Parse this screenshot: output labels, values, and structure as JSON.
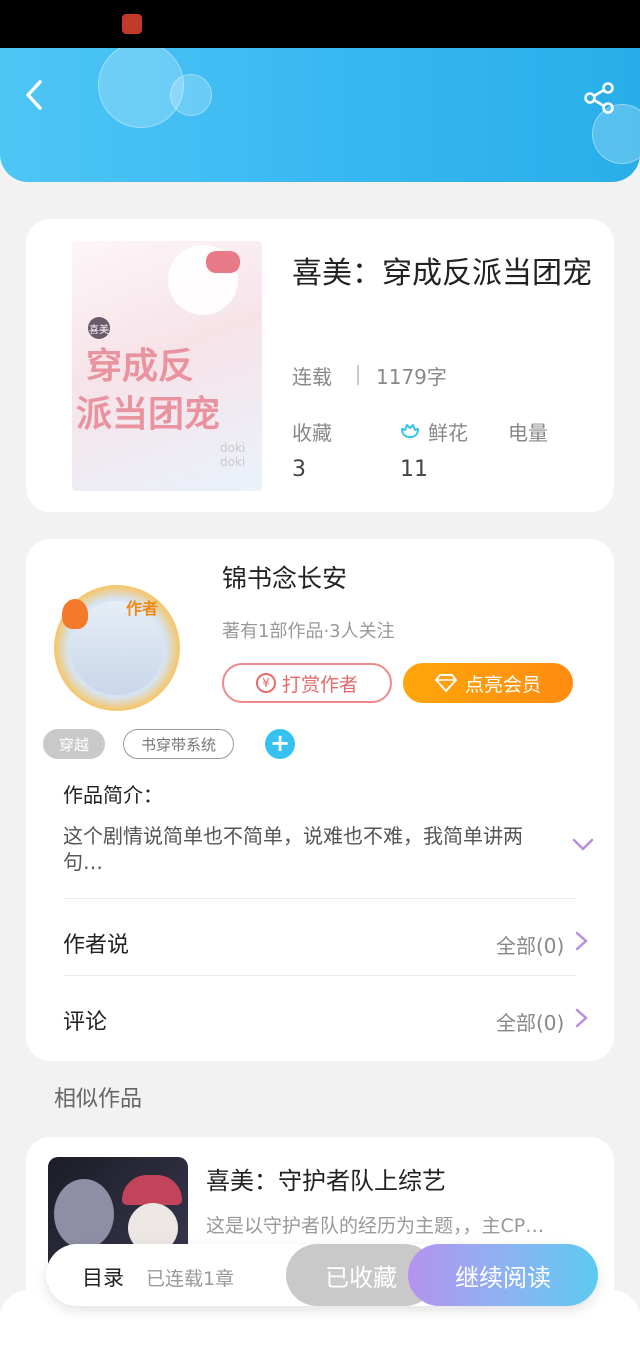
{
  "header": {
    "back_icon": "chevron-left-icon",
    "share_icon": "share-icon",
    "color": "#37b7f2"
  },
  "book": {
    "title": "喜美：穿成反派当团宠",
    "status": "连载",
    "word_count": "1179字",
    "cover_badge": "喜美",
    "cover_text_top": "穿成反",
    "cover_text_bottom": "派当团宠",
    "cover_doki": "doki doki",
    "stats": [
      {
        "label": "收藏",
        "value": "3"
      },
      {
        "label": "鲜花",
        "value": "11",
        "icon": "flower-icon"
      },
      {
        "label": "电量",
        "value": ""
      }
    ]
  },
  "author": {
    "name": "锦书念长安",
    "info": "著有1部作品·3人关注",
    "avatar_badge": "作者",
    "tip_label": "打赏作者",
    "tip_icon": "yen-coin-icon",
    "vip_label": "点亮会员",
    "vip_icon": "diamond-icon"
  },
  "tags": [
    "穿越",
    "书穿带系统"
  ],
  "intro": {
    "label": "作品简介：",
    "text": "这个剧情说简单也不简单，说难也不难，我简单讲两句…"
  },
  "rows": [
    {
      "label": "作者说",
      "value": "全部(0)"
    },
    {
      "label": "评论",
      "value": "全部(0)"
    }
  ],
  "similar": {
    "section_title": "相似作品",
    "items": [
      {
        "title": "喜美：守护者队上综艺",
        "desc": "这是以守护者队的经历为主题，，主CP…"
      }
    ]
  },
  "bottom_bar": {
    "toc_label": "目录",
    "toc_status": "已连载1章",
    "fav_label": "已收藏",
    "read_label": "继续阅读"
  },
  "colors": {
    "accent_blue": "#36c2f0",
    "tip_red": "#e86a6a",
    "vip_orange": "#ff8c10",
    "read_gradient_start": "#b593f0",
    "read_gradient_end": "#5dcaf0"
  }
}
